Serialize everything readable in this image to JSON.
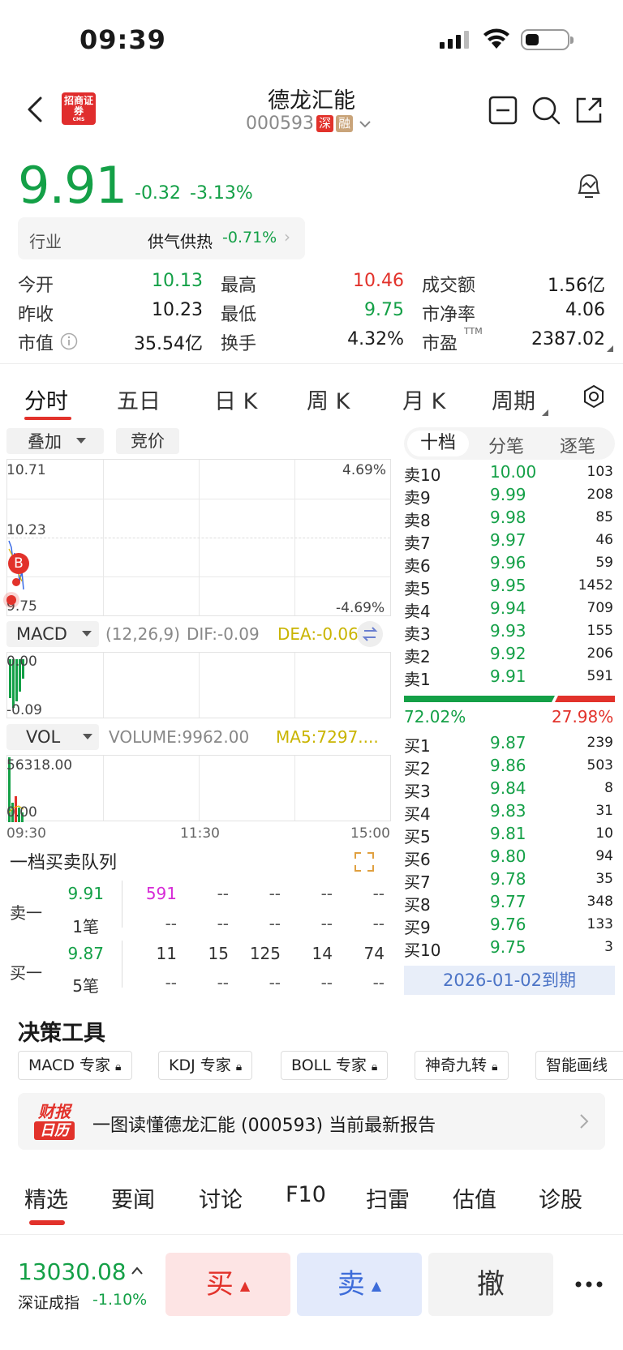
{
  "status_bar": {
    "time": "09:39"
  },
  "header": {
    "broker_logo_text": "招商证券",
    "broker_logo_sub": "CMS",
    "stock_name": "德龙汇能",
    "stock_code": "000593",
    "market_badge": "深",
    "margin_badge": "融"
  },
  "quote": {
    "price": "9.91",
    "change": "-0.32",
    "change_pct": "-3.13%",
    "industry_label": "行业",
    "industry_name": "供气供热",
    "industry_change": "-0.71%",
    "stats": [
      [
        {
          "label": "今开",
          "value": "10.13",
          "color": "green"
        },
        {
          "label": "最高",
          "value": "10.46",
          "color": "red"
        },
        {
          "label": "成交额",
          "value": "1.56亿",
          "color": "black"
        }
      ],
      [
        {
          "label": "昨收",
          "value": "10.23",
          "color": "black"
        },
        {
          "label": "最低",
          "value": "9.75",
          "color": "green"
        },
        {
          "label": "市净率",
          "value": "4.06",
          "color": "black"
        }
      ],
      [
        {
          "label": "市值",
          "value": "35.54亿",
          "color": "black"
        },
        {
          "label": "换手",
          "value": "4.32%",
          "color": "black"
        },
        {
          "label": "市盈",
          "value": "2387.02",
          "color": "black",
          "sup": "TTM"
        }
      ]
    ]
  },
  "chart_tabs": [
    "分时",
    "五日",
    "日 K",
    "周 K",
    "月 K",
    "周期"
  ],
  "chart": {
    "overlay_label": "叠加",
    "auction_label": "竞价",
    "price_high": "10.71",
    "price_mid": "10.23",
    "price_low": "9.75",
    "pct_high": "4.69%",
    "pct_low": "-4.69%",
    "marker_b": "B",
    "macd_label": "MACD",
    "macd_params": "(12,26,9)",
    "macd_dif": "DIF:-0.09",
    "macd_dea": "DEA:-0.06",
    "macd_top": "0.00",
    "macd_bottom": "-0.09",
    "vol_label": "VOL",
    "volume_text": "VOLUME:9962.00",
    "ma5_text": "MA5:7297....",
    "vol_top": "56318.00",
    "vol_bottom": "0.00",
    "time_start": "09:30",
    "time_mid": "11:30",
    "time_end": "15:00"
  },
  "queue": {
    "title": "一档买卖队列",
    "sell_label": "卖一",
    "sell_price": "9.91",
    "sell_count": "1笔",
    "sell_vols": [
      "591",
      "--",
      "--",
      "--",
      "--"
    ],
    "sell_vols2": [
      "--",
      "--",
      "--",
      "--",
      "--"
    ],
    "buy_label": "买一",
    "buy_price": "9.87",
    "buy_count": "5笔",
    "buy_vols": [
      "11",
      "15",
      "125",
      "14",
      "74"
    ],
    "buy_vols2": [
      "--",
      "--",
      "--",
      "--",
      "--"
    ]
  },
  "order_book": {
    "tabs": [
      "十档",
      "分笔",
      "逐笔"
    ],
    "asks": [
      {
        "label": "卖10",
        "price": "10.00",
        "vol": "103"
      },
      {
        "label": "卖9",
        "price": "9.99",
        "vol": "208"
      },
      {
        "label": "卖8",
        "price": "9.98",
        "vol": "85"
      },
      {
        "label": "卖7",
        "price": "9.97",
        "vol": "46"
      },
      {
        "label": "卖6",
        "price": "9.96",
        "vol": "59"
      },
      {
        "label": "卖5",
        "price": "9.95",
        "vol": "1452"
      },
      {
        "label": "卖4",
        "price": "9.94",
        "vol": "709"
      },
      {
        "label": "卖3",
        "price": "9.93",
        "vol": "155"
      },
      {
        "label": "卖2",
        "price": "9.92",
        "vol": "206"
      },
      {
        "label": "卖1",
        "price": "9.91",
        "vol": "591"
      }
    ],
    "buy_ratio": "72.02%",
    "sell_ratio": "27.98%",
    "bids": [
      {
        "label": "买1",
        "price": "9.87",
        "vol": "239"
      },
      {
        "label": "买2",
        "price": "9.86",
        "vol": "503"
      },
      {
        "label": "买3",
        "price": "9.84",
        "vol": "8"
      },
      {
        "label": "买4",
        "price": "9.83",
        "vol": "31"
      },
      {
        "label": "买5",
        "price": "9.81",
        "vol": "10"
      },
      {
        "label": "买6",
        "price": "9.80",
        "vol": "94"
      },
      {
        "label": "买7",
        "price": "9.78",
        "vol": "35"
      },
      {
        "label": "买8",
        "price": "9.77",
        "vol": "348"
      },
      {
        "label": "买9",
        "price": "9.76",
        "vol": "133"
      },
      {
        "label": "买10",
        "price": "9.75",
        "vol": "3"
      }
    ],
    "expiry": "2026-01-02到期"
  },
  "tools": {
    "title": "决策工具",
    "chips": [
      "MACD 专家",
      "KDJ 专家",
      "BOLL 专家",
      "神奇九转",
      "智能画线"
    ]
  },
  "report": {
    "icon_line1": "财报",
    "icon_line2": "日历",
    "text": "一图读懂德龙汇能 (000593) 当前最新报告"
  },
  "news_tabs": [
    "精选",
    "要闻",
    "讨论",
    "F10",
    "扫雷",
    "估值",
    "诊股"
  ],
  "bottom": {
    "index_value": "13030.08",
    "index_name": "深证成指",
    "index_change": "-1.10%",
    "buy": "买",
    "sell": "卖",
    "cancel": "撤"
  },
  "colors": {
    "up": "#e2322b",
    "down": "#14a047",
    "accent": "#e2322b",
    "link": "#4c74c6"
  }
}
